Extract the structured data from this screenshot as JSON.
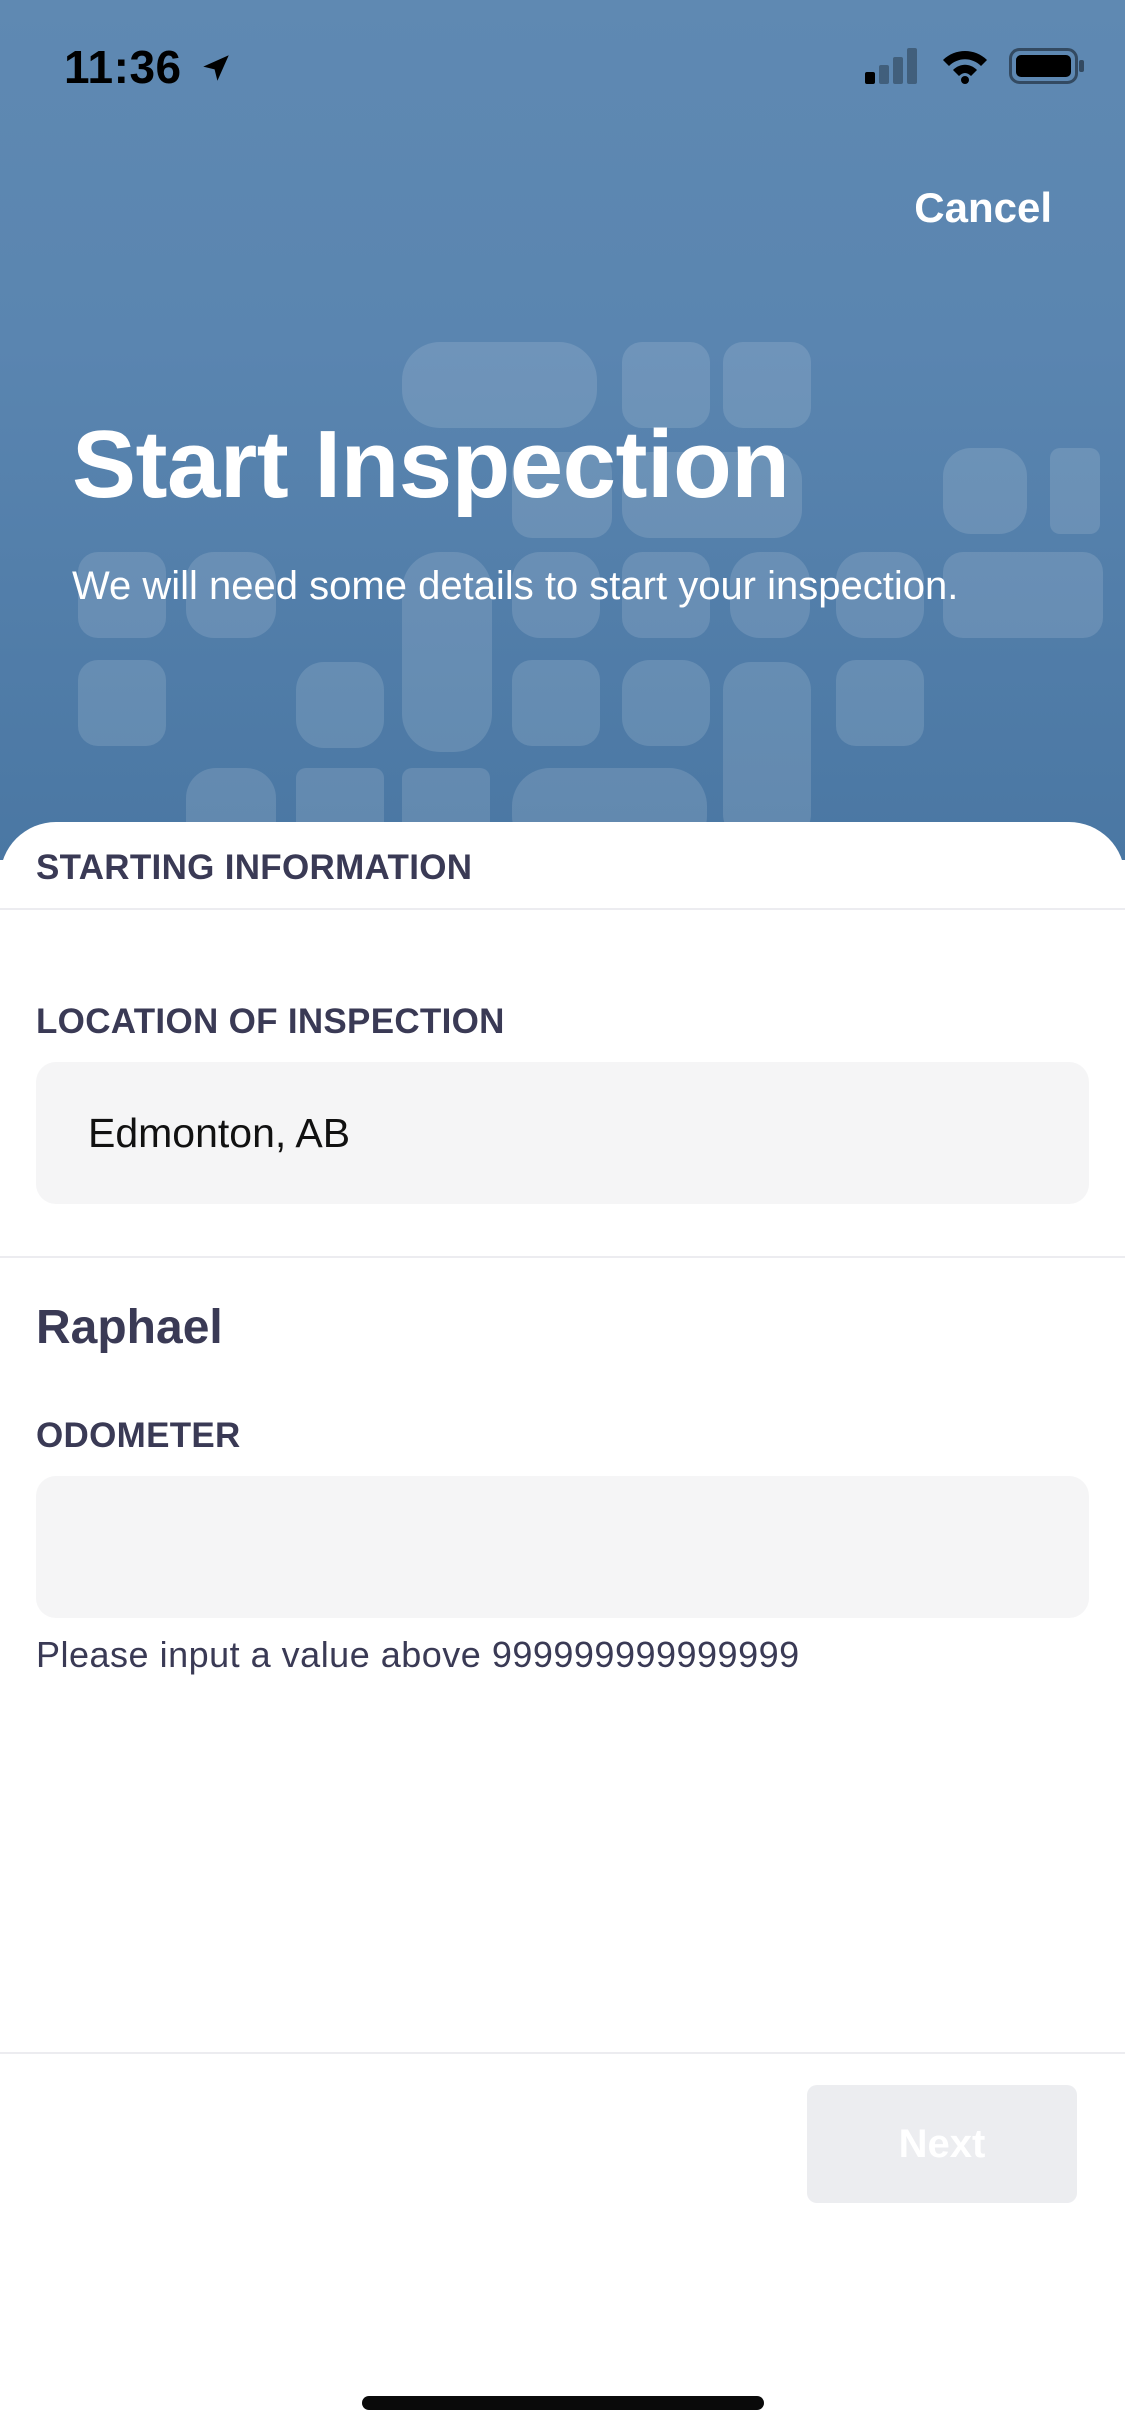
{
  "status_bar": {
    "time": "11:36",
    "icons": [
      "location-arrow-icon",
      "cellular-signal-icon",
      "wifi-icon",
      "battery-icon"
    ]
  },
  "header": {
    "cancel_label": "Cancel",
    "title": "Start Inspection",
    "subtitle": "We will need some details to start your inspection."
  },
  "form": {
    "section_title": "STARTING INFORMATION",
    "location_label": "LOCATION OF INSPECTION",
    "location_value": "Edmonton, AB",
    "person_name": "Raphael",
    "odometer_label": "ODOMETER",
    "odometer_value": "",
    "odometer_helper": "Please input a value above 999999999999999"
  },
  "footer": {
    "next_label": "Next"
  },
  "colors": {
    "header_top": "#5f89b2",
    "header_bottom": "#4a77a3",
    "label_text": "#3a3a55",
    "input_bg": "#f5f5f6",
    "next_disabled_bg": "#ecedf0"
  }
}
